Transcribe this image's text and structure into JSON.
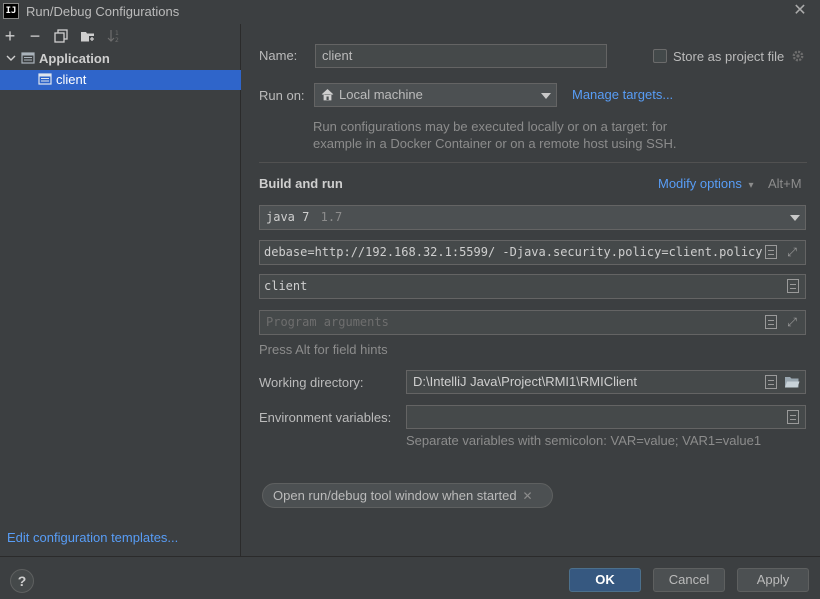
{
  "window": {
    "title": "Run/Debug Configurations",
    "app_icon_text": "IJ"
  },
  "sidebar": {
    "toolbar": [
      {
        "name": "add-icon",
        "glyph": "+"
      },
      {
        "name": "remove-icon",
        "glyph": "−"
      },
      {
        "name": "copy-icon",
        "glyph": "⧉"
      },
      {
        "name": "new-folder-icon",
        "glyph": "▣"
      },
      {
        "name": "sort-icon",
        "glyph": "↓"
      }
    ],
    "tree": {
      "group_label": "Application",
      "item_label": "client"
    },
    "edit_templates_link": "Edit configuration templates..."
  },
  "form": {
    "name_label": "Name:",
    "name_value": "client",
    "store_label": "Store as project file",
    "store_checked": false,
    "run_on_label": "Run on:",
    "run_on_value": "Local machine",
    "manage_targets": "Manage targets...",
    "run_on_hint_1": "Run configurations may be executed locally or on a target: for",
    "run_on_hint_2": "example in a Docker Container or on a remote host using SSH.",
    "section_title": "Build and run",
    "modify_options": "Modify options",
    "modify_shortcut": "Alt+M",
    "jre_value": "java 7",
    "jre_version": "1.7",
    "vm_options": "debase=http://192.168.32.1:5599/ -Djava.security.policy=client.policy",
    "main_class": "client",
    "program_args_placeholder": "Program arguments",
    "field_hints": "Press Alt for field hints",
    "working_dir_label": "Working directory:",
    "working_dir_value": "D:\\IntelliJ Java\\Project\\RMI1\\RMIClient",
    "env_label": "Environment variables:",
    "env_value": "",
    "env_hint": "Separate variables with semicolon: VAR=value; VAR1=value1",
    "chip_label": "Open run/debug tool window when started"
  },
  "footer": {
    "help": "?",
    "ok": "OK",
    "cancel": "Cancel",
    "apply": "Apply"
  },
  "colors": {
    "background": "#3c3f41",
    "selection": "#2f65ca",
    "link": "#589df6",
    "ok_button": "#365880"
  }
}
